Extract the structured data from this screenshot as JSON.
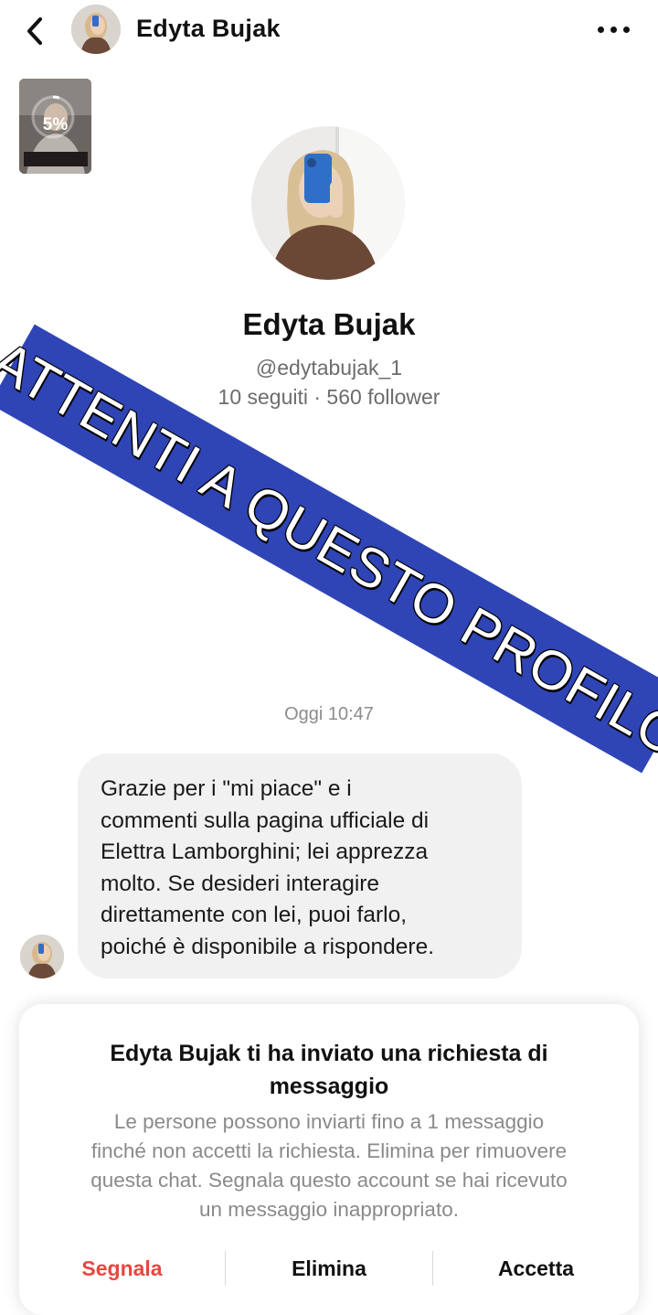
{
  "header": {
    "back_icon": "chevron-left-icon",
    "title": "Edyta Bujak",
    "more_icon": "more-horizontal-icon"
  },
  "video_thumb": {
    "progress_label": "5%",
    "progress": 0.05
  },
  "profile": {
    "name": "Edyta Bujak",
    "handle": "@edytabujak_1",
    "stats": "10 seguiti · 560 follower"
  },
  "banner": {
    "text": "ATTENTI A QUESTO PROFILO",
    "color": "#2f45b6"
  },
  "chat": {
    "timestamp": "Oggi 10:47",
    "messages": [
      {
        "lines": [
          "Grazie per i \"mi piace\" e i",
          "commenti sulla pagina ufficiale di",
          "Elettra Lamborghini; lei apprezza",
          "molto. Se desideri interagire",
          "direttamente con lei, puoi farlo,",
          "poiché è disponibile a rispondere."
        ]
      }
    ]
  },
  "request": {
    "title_line1": "Edyta Bujak ti ha inviato una richiesta di",
    "title_line2": "messaggio",
    "body_lines": [
      "Le persone possono inviarti fino a 1 messaggio",
      "finché non accetti la richiesta. Elimina per rimuovere",
      "questa chat. Segnala questo account se hai ricevuto",
      "un messaggio inappropriato."
    ],
    "report_label": "Segnala",
    "delete_label": "Elimina",
    "accept_label": "Accetta",
    "report_color": "#e5483f"
  }
}
